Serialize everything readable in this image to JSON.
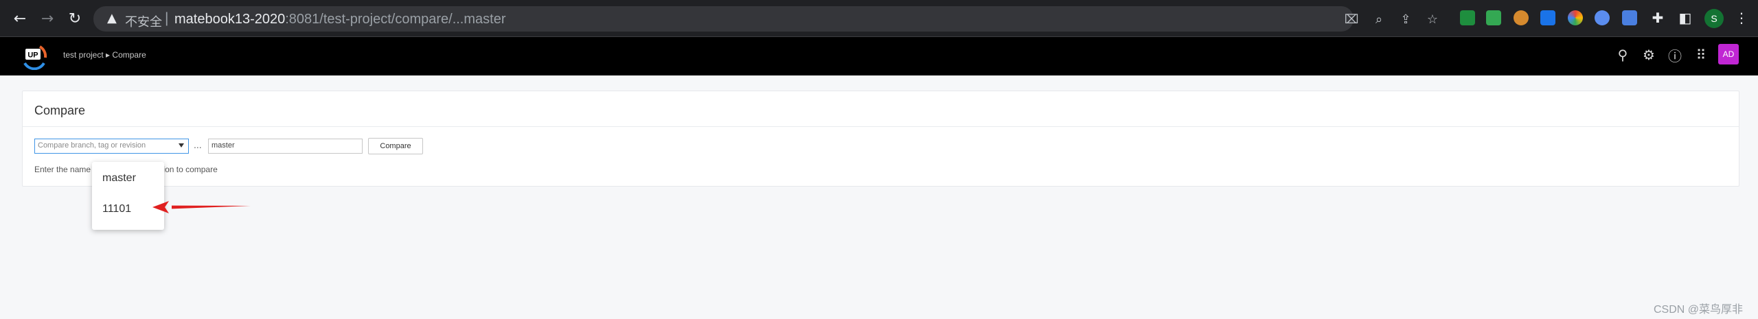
{
  "browser": {
    "insecure_label": "不安全",
    "separator": "|",
    "url_host": "matebook13-2020",
    "url_rest": ":8081/test-project/compare/...master",
    "profile_initial": "S"
  },
  "app": {
    "breadcrumb": [
      "test project",
      "Compare"
    ],
    "breadcrumb_separator": "▸",
    "user_initials": "AD",
    "logo_text": "UP"
  },
  "panel": {
    "title": "Compare",
    "select_placeholder": "Compare branch, tag or revision",
    "range_separator": "...",
    "target_value": "master",
    "compare_button": "Compare",
    "help_start": "Enter the name",
    "help_end": "revision to compare"
  },
  "dropdown": {
    "options": [
      "master",
      "11101"
    ]
  },
  "watermark": "CSDN @菜鸟厚非",
  "colors": {
    "chrome_bg": "#202124",
    "appbar_bg": "#000000",
    "avatar": "#c026d3",
    "select_border": "#3f95e6",
    "annotation_arrow": "#e02020"
  }
}
